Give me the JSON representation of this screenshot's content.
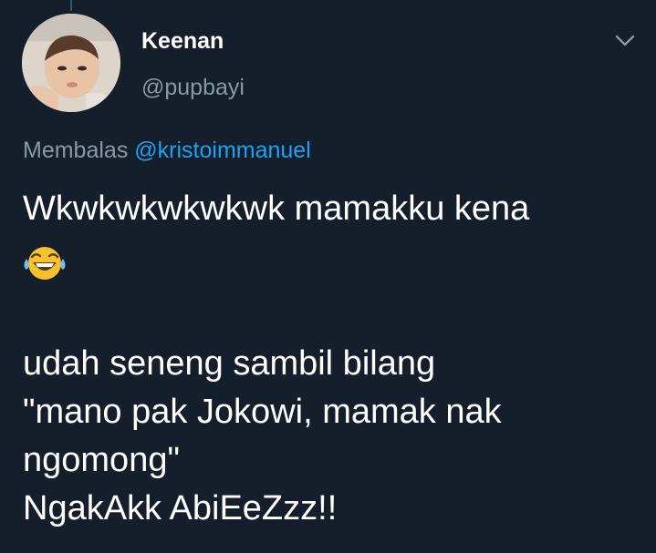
{
  "tweet": {
    "author": {
      "display_name": "Keenan",
      "handle": "@pupbayi",
      "avatar_icon": "baby-photo-avatar"
    },
    "menu_icon": "chevron-down-icon",
    "reply_context": {
      "prefix": "Membalas",
      "mention": "@kristoimmanuel"
    },
    "body": {
      "line1": "Wkwkwkwkwkwk mamakku kena",
      "emoji": "face-with-tears-of-joy",
      "line2": "udah seneng sambil bilang",
      "line3": "\"mano pak Jokowi, mamak nak",
      "line4": "ngomong\"",
      "line5": "NgakAkk AbiEeZzz!!"
    }
  },
  "colors": {
    "background": "#151f2b",
    "primary_text": "#ffffff",
    "secondary_text": "#8899a6",
    "link": "#1da1f2"
  }
}
